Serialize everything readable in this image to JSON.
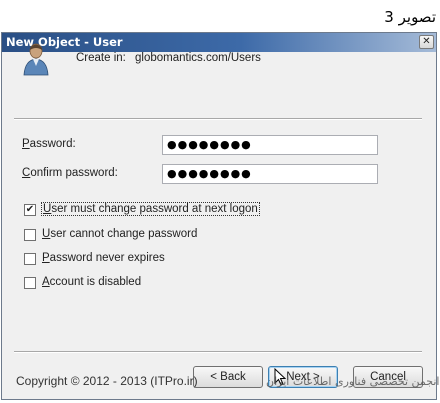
{
  "caption": "تصویر 3",
  "dialog": {
    "title": "New Object - User",
    "close_glyph": "✕",
    "create_in_label": "Create in:",
    "create_in_value": "globomantics.com/Users"
  },
  "password": {
    "label_accel": "P",
    "label_rest": "assword:",
    "value": "●●●●●●●●"
  },
  "confirm_password": {
    "label_accel": "C",
    "label_rest": "onfirm password:",
    "value": "●●●●●●●●"
  },
  "options": [
    {
      "accel": "U",
      "rest": "ser must change password at next logon",
      "checked": true
    },
    {
      "accel": "U",
      "rest": "ser cannot change password",
      "checked": false
    },
    {
      "accel": "P",
      "rest": "assword never expires",
      "checked": false
    },
    {
      "accel": "A",
      "rest": "ccount is disabled",
      "checked": false
    }
  ],
  "checkmark_glyph": "✔",
  "buttons": {
    "back": "< Back",
    "next": "Next >",
    "cancel": "Cancel"
  },
  "watermark_left": "Copyright © 2012 - 2013 (ITPro.ir)",
  "watermark_right": "انجمن تخصصی فناوری اطلاعات ایران"
}
